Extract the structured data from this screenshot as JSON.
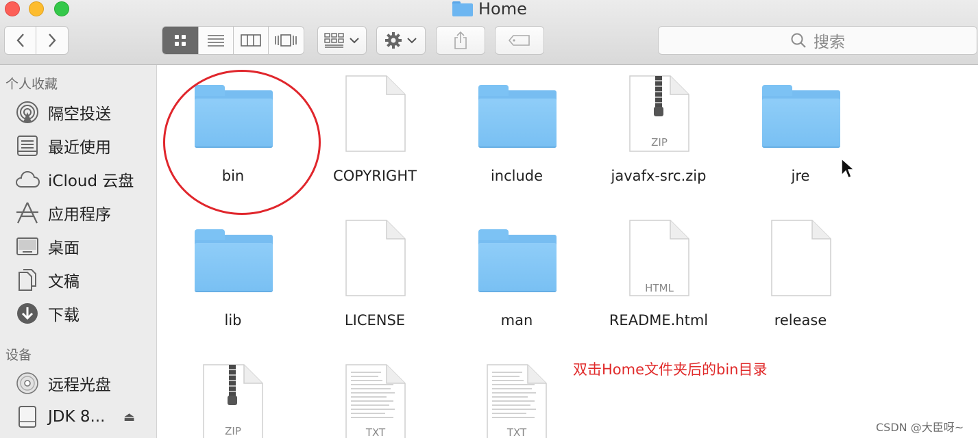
{
  "window": {
    "title": "Home"
  },
  "toolbar": {
    "search_placeholder": "搜索",
    "view_modes": [
      "icon-view",
      "list-view",
      "column-view",
      "cover-flow-view"
    ],
    "active_view": "icon-view"
  },
  "sidebar": {
    "favorites_header": "个人收藏",
    "favorites": [
      {
        "label": "隔空投送",
        "icon": "airdrop-icon"
      },
      {
        "label": "最近使用",
        "icon": "recents-icon"
      },
      {
        "label": "iCloud 云盘",
        "icon": "cloud-icon"
      },
      {
        "label": "应用程序",
        "icon": "applications-icon"
      },
      {
        "label": "桌面",
        "icon": "desktop-icon"
      },
      {
        "label": "文稿",
        "icon": "documents-icon"
      },
      {
        "label": "下载",
        "icon": "downloads-icon"
      }
    ],
    "devices_header": "设备",
    "devices": [
      {
        "label": "远程光盘",
        "icon": "disc-icon"
      },
      {
        "label": "JDK 8...",
        "icon": "drive-icon"
      }
    ]
  },
  "files": [
    {
      "name": "bin",
      "kind": "folder"
    },
    {
      "name": "COPYRIGHT",
      "kind": "document"
    },
    {
      "name": "include",
      "kind": "folder"
    },
    {
      "name": "javafx-src.zip",
      "kind": "zip",
      "tag": "ZIP"
    },
    {
      "name": "jre",
      "kind": "folder"
    },
    {
      "name": "lib",
      "kind": "folder"
    },
    {
      "name": "LICENSE",
      "kind": "document"
    },
    {
      "name": "man",
      "kind": "folder"
    },
    {
      "name": "README.html",
      "kind": "html",
      "tag": "HTML"
    },
    {
      "name": "release",
      "kind": "document"
    },
    {
      "name": "",
      "kind": "zip",
      "tag": "ZIP"
    },
    {
      "name": "",
      "kind": "text",
      "tag": "TXT"
    },
    {
      "name": "",
      "kind": "text",
      "tag": "TXT"
    }
  ],
  "annotation": "双击Home文件夹后的bin目录",
  "watermark": "CSDN @大臣呀~",
  "colors": {
    "highlight_circle": "#e0262c",
    "annotation_text": "#e02a2a",
    "folder_blue": "#79c0f3"
  }
}
